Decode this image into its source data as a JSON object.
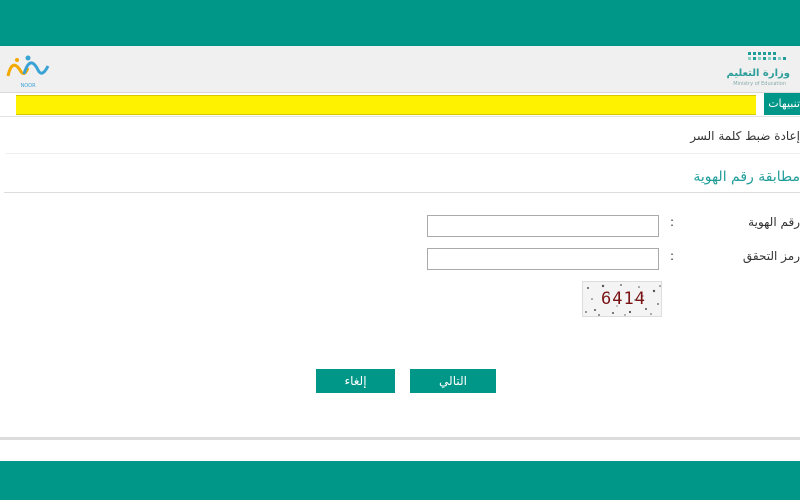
{
  "header": {
    "noor_logo_text": "NOOR",
    "moe_name_ar": "وزارة التعليم",
    "moe_name_en": "Ministry of Education"
  },
  "notice": {
    "tab_label": "تنبيهات"
  },
  "breadcrumb": {
    "title": "إعادة ضبط كلمة السر"
  },
  "section": {
    "title": "مطابقة رقم الهوية"
  },
  "form": {
    "id_label": "رقم الهوية",
    "id_value": "",
    "captcha_label": "رمز التحقق",
    "captcha_value": "",
    "colon": ":",
    "captcha_code": "6414"
  },
  "actions": {
    "next_label": "التالي",
    "cancel_label": "إلغاء"
  },
  "colors": {
    "brand_teal": "#009688",
    "notice_yellow": "#fff200"
  }
}
